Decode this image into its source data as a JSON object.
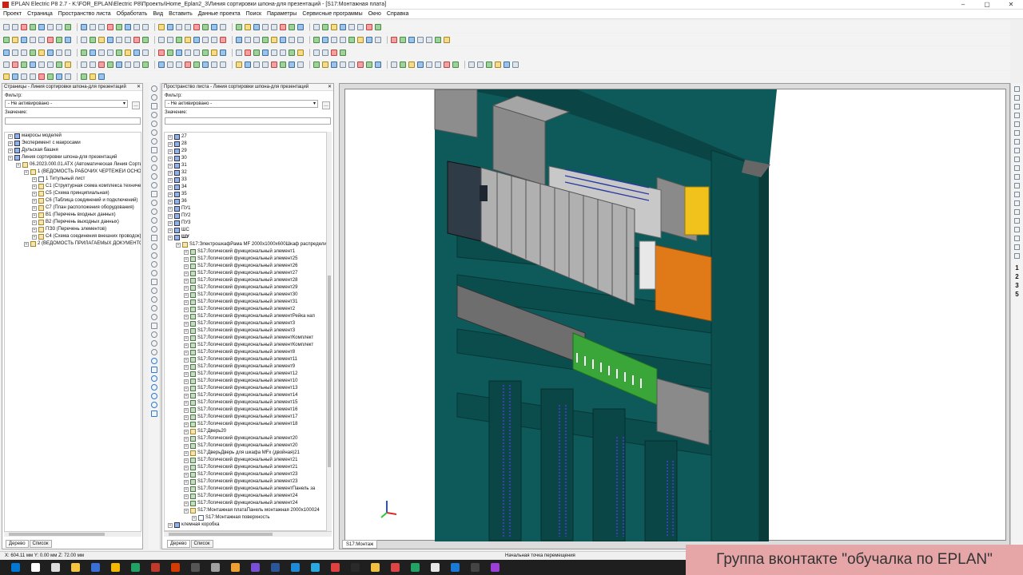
{
  "window": {
    "title": "EPLAN Electric P8 2.7 - K:\\FOR_EPLAN\\Electric P8\\Проекты\\Home_Eplan2_3\\Линия сортировки шпона-для презентаций - [S17:Монтажная плата]"
  },
  "menu": [
    "Проект",
    "Страница",
    "Пространство листа",
    "Обработать",
    "Вид",
    "Вставить",
    "Данные проекта",
    "Поиск",
    "Параметры",
    "Сервисные программы",
    "Окно",
    "Справка"
  ],
  "pages_panel": {
    "title": "Страницы - Линия сортировки шпона-для презентаций",
    "filter_label": "Фильтр:",
    "filter_value": "- Не активировано -",
    "value_label": "Значение:",
    "tree": [
      {
        "label": "макросы моделей",
        "level": 0,
        "icon": "gr"
      },
      {
        "label": "Эксперимент с макросами",
        "level": 0,
        "icon": "gr"
      },
      {
        "label": "Дульская башня",
        "level": 0,
        "icon": "gr"
      },
      {
        "label": "Линия сортировки шпона-для презентаций",
        "level": 0,
        "icon": "gr"
      },
      {
        "label": "06.2023.000.01.АТХ (Автоматическая Линия Сортировки)",
        "level": 1,
        "icon": "f"
      },
      {
        "label": "1 (ВЕДОМОСТЬ РАБОЧИХ ЧЕРТЕЖЕЙ ОСНОВНОГО КОМПЛЕКТА)",
        "level": 2,
        "icon": "f"
      },
      {
        "label": "1 Титульный лист",
        "level": 3,
        "icon": "pg"
      },
      {
        "label": "С1 (Структурная схема комплекса технических средств)",
        "level": 3,
        "icon": "f"
      },
      {
        "label": "С5 (Схема принципиальная)",
        "level": 3,
        "icon": "f"
      },
      {
        "label": "С6 (Таблица соединений и подключений)",
        "level": 3,
        "icon": "f"
      },
      {
        "label": "С7 (План расположения оборудования)",
        "level": 3,
        "icon": "f"
      },
      {
        "label": "В1 (Перечень входных данных)",
        "level": 3,
        "icon": "f"
      },
      {
        "label": "В2 (Перечень выходных данных)",
        "level": 3,
        "icon": "f"
      },
      {
        "label": "ПЭ3 (Перечень элементов)",
        "level": 3,
        "icon": "f"
      },
      {
        "label": "С4 (Схема соединения внешних проводок)",
        "level": 3,
        "icon": "f"
      },
      {
        "label": "2 (ВЕДОМОСТЬ ПРИЛАГАЕМЫХ ДОКУМЕНТОВ)",
        "level": 2,
        "icon": "f"
      }
    ],
    "tabs": [
      "Дерево",
      "Список"
    ]
  },
  "layout_panel": {
    "title": "Пространство листа - Линия сортировки шпона-для презентаций",
    "filter_label": "Фильтр:",
    "filter_value": "- Не активировано -",
    "value_label": "Значение:",
    "tree": [
      {
        "label": "27",
        "level": 0,
        "icon": "gr"
      },
      {
        "label": "28",
        "level": 0,
        "icon": "gr"
      },
      {
        "label": "29",
        "level": 0,
        "icon": "gr"
      },
      {
        "label": "30",
        "level": 0,
        "icon": "gr"
      },
      {
        "label": "31",
        "level": 0,
        "icon": "gr"
      },
      {
        "label": "32",
        "level": 0,
        "icon": "gr"
      },
      {
        "label": "33",
        "level": 0,
        "icon": "gr"
      },
      {
        "label": "34",
        "level": 0,
        "icon": "gr"
      },
      {
        "label": "35",
        "level": 0,
        "icon": "gr"
      },
      {
        "label": "36",
        "level": 0,
        "icon": "gr"
      },
      {
        "label": "ПУ1",
        "level": 0,
        "icon": "gr"
      },
      {
        "label": "ПУ2",
        "level": 0,
        "icon": "gr"
      },
      {
        "label": "ПУ3",
        "level": 0,
        "icon": "gr"
      },
      {
        "label": "ШС",
        "level": 0,
        "icon": "gr"
      },
      {
        "label": "ШУ",
        "level": 0,
        "icon": "gr",
        "bold": true
      },
      {
        "label": "S17:ЭлектрошкафРама MF 2000х1000х600Шкаф распределительный",
        "level": 1,
        "icon": "f"
      },
      {
        "label": "S17:Логический функциональный элемент1",
        "level": 2,
        "icon": "el"
      },
      {
        "label": "S17:Логический функциональный элемент25",
        "level": 2,
        "icon": "el"
      },
      {
        "label": "S17:Логический функциональный элемент26",
        "level": 2,
        "icon": "el"
      },
      {
        "label": "S17:Логический функциональный элемент27",
        "level": 2,
        "icon": "el"
      },
      {
        "label": "S17:Логический функциональный элемент28",
        "level": 2,
        "icon": "el"
      },
      {
        "label": "S17:Логический функциональный элемент29",
        "level": 2,
        "icon": "el"
      },
      {
        "label": "S17:Логический функциональный элемент30",
        "level": 2,
        "icon": "el"
      },
      {
        "label": "S17:Логический функциональный элемент31",
        "level": 2,
        "icon": "el"
      },
      {
        "label": "S17:Логический функциональный элемент2",
        "level": 2,
        "icon": "el"
      },
      {
        "label": "S17:Логический функциональный элементРейка нап",
        "level": 2,
        "icon": "el"
      },
      {
        "label": "S17:Логический функциональный элемент3",
        "level": 2,
        "icon": "el"
      },
      {
        "label": "S17:Логический функциональный элемент3",
        "level": 2,
        "icon": "el"
      },
      {
        "label": "S17:Логический функциональный элементКомплект",
        "level": 2,
        "icon": "el"
      },
      {
        "label": "S17:Логический функциональный элементКомплект",
        "level": 2,
        "icon": "el"
      },
      {
        "label": "S17:Логический функциональный элемент8",
        "level": 2,
        "icon": "el"
      },
      {
        "label": "S17:Логический функциональный элемент11",
        "level": 2,
        "icon": "el"
      },
      {
        "label": "S17:Логический функциональный элемент9",
        "level": 2,
        "icon": "el"
      },
      {
        "label": "S17:Логический функциональный элемент12",
        "level": 2,
        "icon": "el"
      },
      {
        "label": "S17:Логический функциональный элемент10",
        "level": 2,
        "icon": "el"
      },
      {
        "label": "S17:Логический функциональный элемент13",
        "level": 2,
        "icon": "el"
      },
      {
        "label": "S17:Логический функциональный элемент14",
        "level": 2,
        "icon": "el"
      },
      {
        "label": "S17:Логический функциональный элемент15",
        "level": 2,
        "icon": "el"
      },
      {
        "label": "S17:Логический функциональный элемент16",
        "level": 2,
        "icon": "el"
      },
      {
        "label": "S17:Логический функциональный элемент17",
        "level": 2,
        "icon": "el"
      },
      {
        "label": "S17:Логический функциональный элемент18",
        "level": 2,
        "icon": "el"
      },
      {
        "label": "S17:Дверь20",
        "level": 2,
        "icon": "f"
      },
      {
        "label": "S17:Логический функциональный элемент20",
        "level": 2,
        "icon": "el"
      },
      {
        "label": "S17:Логический функциональный элемент20",
        "level": 2,
        "icon": "el"
      },
      {
        "label": "S17:ДверьДверь для шкафа MFx (двойная)21",
        "level": 2,
        "icon": "f"
      },
      {
        "label": "S17:Логический функциональный элемент21",
        "level": 2,
        "icon": "el"
      },
      {
        "label": "S17:Логический функциональный элемент21",
        "level": 2,
        "icon": "el"
      },
      {
        "label": "S17:Логический функциональный элемент23",
        "level": 2,
        "icon": "el"
      },
      {
        "label": "S17:Логический функциональный элемент23",
        "level": 2,
        "icon": "el"
      },
      {
        "label": "S17:Логический функциональный элементПанель за",
        "level": 2,
        "icon": "el"
      },
      {
        "label": "S17:Логический функциональный элемент24",
        "level": 2,
        "icon": "el"
      },
      {
        "label": "S17:Логический функциональный элемент24",
        "level": 2,
        "icon": "el"
      },
      {
        "label": "S17:Монтажная платаПанель монтажная 2000х100024",
        "level": 2,
        "icon": "f"
      },
      {
        "label": "S17:Монтажная поверхность",
        "level": 3,
        "icon": "pg"
      },
      {
        "label": "клемная коробка",
        "level": 0,
        "icon": "gr"
      }
    ],
    "tabs": [
      "Дерево",
      "Список"
    ]
  },
  "viewport": {
    "tab": "S17:Монтаж"
  },
  "status": {
    "coords": "X: 604.11 мм   Y: 0.00 мм   Z: 72.00 мм",
    "message": "Начальная точка перемещения"
  },
  "right_tools": [
    "1",
    "2",
    "3",
    "5"
  ],
  "banner": "Группа вконтакте \"обучалка по EPLAN\"",
  "colors": {
    "cabinet": "#0e5a5a",
    "cabinet_dark": "#0a4444",
    "module_gray": "#9a9a9a",
    "orange_plate": "#e07a18",
    "terminal_green": "#39c23a",
    "banner_bg": "#e6a6a8"
  }
}
